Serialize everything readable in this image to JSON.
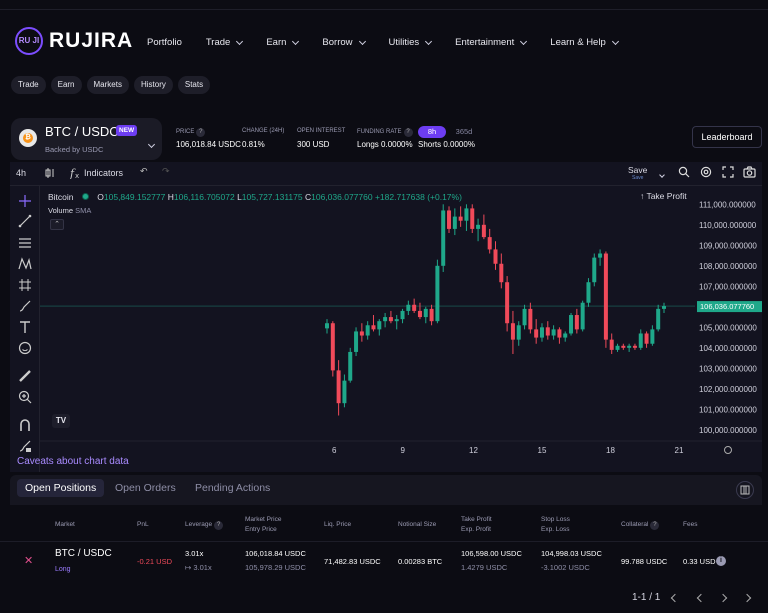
{
  "brand": {
    "name": "RUJIRA",
    "mark": "RU JI"
  },
  "nav": [
    {
      "label": "Portfolio",
      "dropdown": false
    },
    {
      "label": "Trade",
      "dropdown": true
    },
    {
      "label": "Earn",
      "dropdown": true
    },
    {
      "label": "Borrow",
      "dropdown": true
    },
    {
      "label": "Utilities",
      "dropdown": true
    },
    {
      "label": "Entertainment",
      "dropdown": true
    },
    {
      "label": "Learn & Help",
      "dropdown": true
    }
  ],
  "subnav": [
    "Trade",
    "Earn",
    "Markets",
    "History",
    "Stats"
  ],
  "market": {
    "pair": "BTC / USDC",
    "badge": "NEW",
    "backed": "Backed by USDC",
    "coin_icon": "bitcoin-icon"
  },
  "stats": {
    "price_label": "PRICE",
    "price": "106,018.84 USDC",
    "change_label": "CHANGE (24H)",
    "change": "0.81%",
    "oi_label": "OPEN INTEREST",
    "oi": "300 USD",
    "funding_label": "FUNDING RATE",
    "funding_longs": "Longs 0.0000%",
    "funding_shorts": "Shorts 0.0000%",
    "funding_tab_active": "8h",
    "funding_tab_other": "365d"
  },
  "leaderboard_label": "Leaderboard",
  "chart_toolbar": {
    "interval": "4h",
    "indicators": "Indicators",
    "save": "Save",
    "save_sub": "Save"
  },
  "legend": {
    "symbol": "Bitcoin",
    "o_label": "O",
    "o": "105,849.152777",
    "h_label": "H",
    "h": "106,116.705072",
    "l_label": "L",
    "l": "105,727.131175",
    "c_label": "C",
    "c": "106,036.077760",
    "change": "+182.717638 (+0.17%)",
    "volume": "Volume",
    "volume_type": "SMA"
  },
  "take_profit_label": "↑ Take Profit",
  "price_tag": "106,036.077760",
  "caveats": "Caveats about chart data",
  "chart_data": {
    "type": "candlestick",
    "y_ticks": [
      "111,000.000000",
      "110,000.000000",
      "109,000.000000",
      "108,000.000000",
      "107,000.000000",
      "106,000.000000",
      "105,000.000000",
      "104,000.000000",
      "103,000.000000",
      "102,000.000000",
      "101,000.000000",
      "100,000.000000"
    ],
    "x_ticks": [
      "6",
      "9",
      "12",
      "15",
      "18",
      "21"
    ],
    "ylim": [
      99700,
      111600
    ],
    "current_price": 106036.08,
    "colors": {
      "up": "#1fa88a",
      "down": "#f04a5a"
    },
    "candles": [
      [
        104950,
        105400,
        104700,
        105200
      ],
      [
        105200,
        105300,
        102600,
        102900
      ],
      [
        102900,
        103400,
        100700,
        101300
      ],
      [
        101300,
        102700,
        101100,
        102400
      ],
      [
        102400,
        104000,
        102300,
        103800
      ],
      [
        103800,
        105000,
        103600,
        104800
      ],
      [
        104800,
        105200,
        104300,
        104600
      ],
      [
        104600,
        105300,
        104400,
        105100
      ],
      [
        105100,
        105600,
        104800,
        104900
      ],
      [
        104900,
        105400,
        104600,
        105300
      ],
      [
        105300,
        105700,
        105000,
        105500
      ],
      [
        105500,
        105800,
        105200,
        105300
      ],
      [
        105300,
        105600,
        104900,
        105400
      ],
      [
        105400,
        105900,
        105200,
        105800
      ],
      [
        105800,
        106300,
        105600,
        106100
      ],
      [
        106100,
        106400,
        105700,
        105800
      ],
      [
        105800,
        106200,
        105400,
        105500
      ],
      [
        105500,
        106000,
        105200,
        105900
      ],
      [
        105900,
        106100,
        105100,
        105300
      ],
      [
        105300,
        108300,
        105200,
        108000
      ],
      [
        108000,
        111000,
        107700,
        110700
      ],
      [
        110700,
        110900,
        109600,
        109800
      ],
      [
        109800,
        110800,
        109500,
        110400
      ],
      [
        110400,
        110900,
        109900,
        110200
      ],
      [
        110200,
        111000,
        109700,
        110800
      ],
      [
        110800,
        111000,
        109600,
        109800
      ],
      [
        109800,
        110300,
        109200,
        110000
      ],
      [
        110000,
        110500,
        109300,
        109400
      ],
      [
        109400,
        109800,
        108600,
        108800
      ],
      [
        108800,
        109200,
        107800,
        108100
      ],
      [
        108100,
        108600,
        106900,
        107200
      ],
      [
        107200,
        107500,
        104800,
        105200
      ],
      [
        105200,
        105800,
        103700,
        104400
      ],
      [
        104400,
        105300,
        104100,
        105100
      ],
      [
        105100,
        106100,
        104900,
        105900
      ],
      [
        105900,
        106200,
        104700,
        104900
      ],
      [
        104900,
        105400,
        104200,
        104500
      ],
      [
        104500,
        105200,
        104300,
        105000
      ],
      [
        105000,
        105300,
        104400,
        104600
      ],
      [
        104600,
        105100,
        104400,
        104900
      ],
      [
        104900,
        105000,
        104200,
        104500
      ],
      [
        104500,
        104800,
        104300,
        104700
      ],
      [
        104700,
        105700,
        104600,
        105600
      ],
      [
        105600,
        105900,
        104700,
        104900
      ],
      [
        104900,
        106300,
        104800,
        106200
      ],
      [
        106200,
        107400,
        106000,
        107200
      ],
      [
        107200,
        108600,
        107000,
        108400
      ],
      [
        108400,
        108800,
        108000,
        108600
      ],
      [
        108600,
        108700,
        104000,
        104400
      ],
      [
        104400,
        104700,
        103700,
        103900
      ],
      [
        103900,
        104200,
        103800,
        104100
      ],
      [
        104100,
        104200,
        103900,
        104000
      ],
      [
        104000,
        104200,
        103800,
        104100
      ],
      [
        104100,
        104200,
        103900,
        104000
      ],
      [
        104000,
        104900,
        103900,
        104700
      ],
      [
        104700,
        104800,
        104000,
        104200
      ],
      [
        104200,
        105100,
        104100,
        104900
      ],
      [
        104900,
        106100,
        104800,
        105900
      ],
      [
        105900,
        106200,
        105700,
        106036
      ]
    ]
  },
  "tabs": [
    "Open Positions",
    "Open Orders",
    "Pending Actions"
  ],
  "table": {
    "headers": {
      "market": "Market",
      "pnl": "PnL",
      "leverage": "Leverage",
      "market_price": "Market Price",
      "entry_price": "Entry Price",
      "liq_price": "Liq. Price",
      "notional": "Notional Size",
      "take_profit": "Take Profit",
      "exp_profit": "Exp. Profit",
      "stop_loss": "Stop Loss",
      "exp_loss": "Exp. Loss",
      "collateral": "Collateral",
      "fees": "Fees"
    },
    "rows": [
      {
        "market": "BTC / USDC",
        "side": "Long",
        "pnl": "-0.21 USD",
        "leverage": "3.01x",
        "leverage_target": "3.01x",
        "market_price": "106,018.84 USDC",
        "entry_price": "105,978.29 USDC",
        "liq_price": "71,482.83 USDC",
        "notional": "0.00283 BTC",
        "take_profit": "106,598.00 USDC",
        "exp_profit": "1.4279 USDC",
        "stop_loss": "104,998.03 USDC",
        "exp_loss": "-3.1002 USDC",
        "collateral": "99.788 USDC",
        "fees": "0.33 USD"
      }
    ]
  },
  "pagination": {
    "label": "1-1 / 1"
  }
}
